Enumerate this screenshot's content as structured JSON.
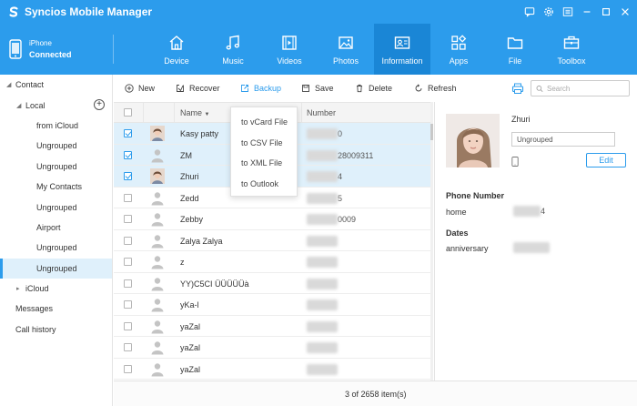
{
  "app": {
    "title": "Syncios Mobile Manager"
  },
  "device": {
    "name": "iPhone",
    "status": "Connected"
  },
  "nav": {
    "tabs": [
      {
        "label": "Device",
        "icon": "home-icon",
        "active": false
      },
      {
        "label": "Music",
        "icon": "music-note-icon",
        "active": false
      },
      {
        "label": "Videos",
        "icon": "film-icon",
        "active": false
      },
      {
        "label": "Photos",
        "icon": "image-icon",
        "active": false
      },
      {
        "label": "Information",
        "icon": "contact-card-icon",
        "active": true
      },
      {
        "label": "Apps",
        "icon": "apps-grid-icon",
        "active": false
      },
      {
        "label": "File",
        "icon": "folder-icon",
        "active": false
      },
      {
        "label": "Toolbox",
        "icon": "toolbox-icon",
        "active": false
      }
    ]
  },
  "sidebar": {
    "contact": "Contact",
    "local": "Local",
    "groups": [
      "from iCloud",
      "Ungrouped",
      "Ungrouped",
      "My Contacts",
      "Ungrouped",
      "Airport",
      "Ungrouped",
      "Ungrouped"
    ],
    "selected_group_index": 7,
    "icloud": "iCloud",
    "messages": "Messages",
    "call_history": "Call history"
  },
  "toolbar": {
    "new": "New",
    "recover": "Recover",
    "backup": "Backup",
    "save": "Save",
    "delete": "Delete",
    "refresh": "Refresh",
    "search_placeholder": "Search"
  },
  "backup_menu": [
    "to vCard File",
    "to CSV File",
    "to XML File",
    "to Outlook"
  ],
  "table": {
    "columns": {
      "name": "Name",
      "number": "Number"
    },
    "rows": [
      {
        "name": "Kasy patty",
        "number_suffix": "0",
        "checked": true,
        "photo": true
      },
      {
        "name": "ZM",
        "number_suffix": "28009311",
        "checked": true,
        "photo": false
      },
      {
        "name": "Zhuri",
        "number_suffix": "4",
        "checked": true,
        "photo": true
      },
      {
        "name": "Zedd",
        "number_suffix": "5",
        "checked": false,
        "photo": false
      },
      {
        "name": "Zebby",
        "number_suffix": "0009",
        "checked": false,
        "photo": false
      },
      {
        "name": "Zalya Zalya",
        "number_suffix": "",
        "checked": false,
        "photo": false
      },
      {
        "name": "z",
        "number_suffix": "",
        "checked": false,
        "photo": false
      },
      {
        "name": "YY)C5CI ÜÜÜÜÜà",
        "number_suffix": "",
        "checked": false,
        "photo": false
      },
      {
        "name": "yKa-l",
        "number_suffix": "",
        "checked": false,
        "photo": false
      },
      {
        "name": "yaZal",
        "number_suffix": "",
        "checked": false,
        "photo": false
      },
      {
        "name": "yaZal",
        "number_suffix": "",
        "checked": false,
        "photo": false
      },
      {
        "name": "yaZal",
        "number_suffix": "",
        "checked": false,
        "photo": false
      }
    ]
  },
  "footer": {
    "count": "3 of 2658 item(s)"
  },
  "detail": {
    "name": "Zhuri",
    "group": "Ungrouped",
    "edit": "Edit",
    "phone_section": "Phone Number",
    "phone_label": "home",
    "phone_suffix": "4",
    "dates_section": "Dates",
    "date_label": "anniversary"
  },
  "colors": {
    "accent": "#2c9cec",
    "accent_dark": "#1a86d6",
    "selected_row": "#dff0fb"
  }
}
